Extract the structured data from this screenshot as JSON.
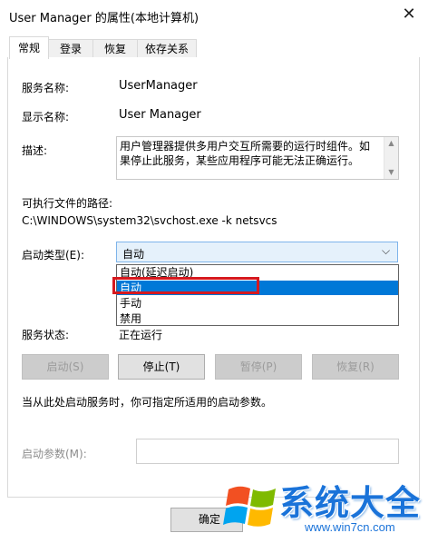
{
  "window": {
    "title": "User Manager 的属性(本地计算机)",
    "close_glyph": "✕"
  },
  "tabs": [
    {
      "label": "常规"
    },
    {
      "label": "登录"
    },
    {
      "label": "恢复"
    },
    {
      "label": "依存关系"
    }
  ],
  "general": {
    "service_name_label": "服务名称:",
    "service_name_value": "UserManager",
    "display_name_label": "显示名称:",
    "display_name_value": "User Manager",
    "description_label": "描述:",
    "description_text": "用户管理器提供多用户交互所需要的运行时组件。如果停止此服务，某些应用程序可能无法正确运行。",
    "exec_path_label": "可执行文件的路径:",
    "exec_path_value": "C:\\WINDOWS\\system32\\svchost.exe -k netsvcs",
    "startup_type_label": "启动类型(E):",
    "startup_type_value": "自动",
    "startup_options": [
      "自动(延迟启动)",
      "自动",
      "手动",
      "禁用"
    ],
    "selected_option_index": 1,
    "service_status_label": "服务状态:",
    "service_status_value": "正在运行",
    "buttons": {
      "start": "启动(S)",
      "stop": "停止(T)",
      "pause": "暂停(P)",
      "resume": "恢复(R)"
    },
    "hint_text": "当从此处启动服务时，你可指定所适用的启动参数。",
    "start_params_label": "启动参数(M):",
    "start_params_value": ""
  },
  "footer": {
    "ok_label": "确定"
  },
  "watermark": {
    "brand_text": "系统大全",
    "url_text": "www.win7cn.com"
  },
  "icons": {
    "close": "close-icon",
    "dropdown": "chevron-down-icon",
    "scroll_up": "arrow-up-icon",
    "scroll_down": "arrow-down-icon",
    "logo": "windows-flag-icon"
  },
  "colors": {
    "selection": "#0078d7",
    "highlight_box": "#d6191f",
    "watermark_blue": "#1a73d9"
  }
}
